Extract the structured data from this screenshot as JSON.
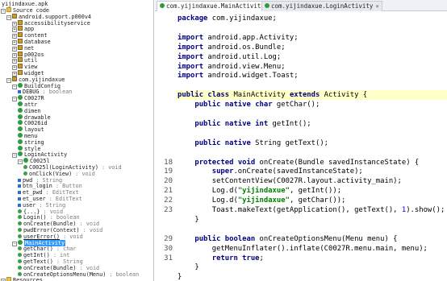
{
  "tree": {
    "root": "yijindaxue.apk",
    "items": [
      {
        "label": "Source code",
        "type": "",
        "indent": 0
      },
      {
        "label": "android.support.p000v4",
        "type": "",
        "indent": 1
      },
      {
        "label": "accessibilityservice",
        "type": "",
        "indent": 2
      },
      {
        "label": "app",
        "type": "",
        "indent": 2
      },
      {
        "label": "content",
        "type": "",
        "indent": 2
      },
      {
        "label": "database",
        "type": "",
        "indent": 2
      },
      {
        "label": "net",
        "type": "",
        "indent": 2
      },
      {
        "label": "p002os",
        "type": "",
        "indent": 2
      },
      {
        "label": "util",
        "type": "",
        "indent": 2
      },
      {
        "label": "view",
        "type": "",
        "indent": 2
      },
      {
        "label": "widget",
        "type": "",
        "indent": 2
      },
      {
        "label": "com.yijindaxue",
        "type": "",
        "indent": 1
      },
      {
        "label": "BuildConfig",
        "type": "",
        "indent": 2
      },
      {
        "label": "DEBUG",
        "type": ": boolean",
        "indent": 3
      },
      {
        "label": "C0027R",
        "type": "",
        "indent": 2
      },
      {
        "label": "attr",
        "type": "",
        "indent": 3
      },
      {
        "label": "dimen",
        "type": "",
        "indent": 3
      },
      {
        "label": "drawable",
        "type": "",
        "indent": 3
      },
      {
        "label": "C0026id",
        "type": "",
        "indent": 3
      },
      {
        "label": "layout",
        "type": "",
        "indent": 3
      },
      {
        "label": "menu",
        "type": "",
        "indent": 3
      },
      {
        "label": "string",
        "type": "",
        "indent": 3
      },
      {
        "label": "style",
        "type": "",
        "indent": 3
      },
      {
        "label": "LoginActivity",
        "type": "",
        "indent": 2
      },
      {
        "label": "C0025l",
        "type": "",
        "indent": 3
      },
      {
        "label": "C0025l(LoginActivity)",
        "type": ": void",
        "indent": 4
      },
      {
        "label": "onClick(View)",
        "type": ": void",
        "indent": 4
      },
      {
        "label": "pwd",
        "type": ": String",
        "indent": 3
      },
      {
        "label": "btn_login",
        "type": ": Button",
        "indent": 3
      },
      {
        "label": "et_pwd",
        "type": ": EditText",
        "indent": 3
      },
      {
        "label": "et_user",
        "type": ": EditText",
        "indent": 3
      },
      {
        "label": "user",
        "type": ": String",
        "indent": 3
      },
      {
        "label": "{...}",
        "type": ": void",
        "indent": 3
      },
      {
        "label": "Login()",
        "type": ": boolean",
        "indent": 3
      },
      {
        "label": "onCreate(Bundle)",
        "type": ": void",
        "indent": 3
      },
      {
        "label": "pwdError(Context)",
        "type": ": void",
        "indent": 3
      },
      {
        "label": "userError()",
        "type": ": void",
        "indent": 3
      },
      {
        "label": "MainActivity",
        "type": "",
        "indent": 2
      },
      {
        "label": "getChar()",
        "type": ": char",
        "indent": 3
      },
      {
        "label": "getInt()",
        "type": ": int",
        "indent": 3
      },
      {
        "label": "getText()",
        "type": ": String",
        "indent": 3
      },
      {
        "label": "onCreate(Bundle)",
        "type": ": void",
        "indent": 3
      },
      {
        "label": "onCreateOptionsMenu(Menu)",
        "type": ": boolean",
        "indent": 3
      },
      {
        "label": "Resources",
        "type": "",
        "indent": 0
      }
    ]
  },
  "tabs": [
    {
      "label": "com.yijindaxue.MainActivity",
      "close": "×"
    },
    {
      "label": "com.yijindaxue.LoginActivity",
      "close": "×"
    }
  ],
  "code": {
    "lines": [
      {
        "ln": "",
        "text": "package com.yijindaxue;"
      },
      {
        "ln": "",
        "text": ""
      },
      {
        "ln": "",
        "text": "import android.app.Activity;"
      },
      {
        "ln": "",
        "text": "import android.os.Bundle;"
      },
      {
        "ln": "",
        "text": "import android.util.Log;"
      },
      {
        "ln": "",
        "text": "import android.view.Menu;"
      },
      {
        "ln": "",
        "text": "import android.widget.Toast;"
      },
      {
        "ln": "",
        "text": ""
      },
      {
        "ln": "",
        "text": "public class MainActivity extends Activity {"
      },
      {
        "ln": "",
        "text": "    public native char getChar();"
      },
      {
        "ln": "",
        "text": ""
      },
      {
        "ln": "",
        "text": "    public native int getInt();"
      },
      {
        "ln": "",
        "text": ""
      },
      {
        "ln": "",
        "text": "    public native String getText();"
      },
      {
        "ln": "",
        "text": ""
      },
      {
        "ln": "18",
        "text": "    protected void onCreate(Bundle savedInstanceState) {"
      },
      {
        "ln": "19",
        "text": "        super.onCreate(savedInstanceState);"
      },
      {
        "ln": "20",
        "text": "        setContentView(C0027R.layout.activity_main);"
      },
      {
        "ln": "21",
        "text": "        Log.d(\"yijindaxue\", getInt());"
      },
      {
        "ln": "22",
        "text": "        Log.d(\"yijindaxue\", getChar());"
      },
      {
        "ln": "23",
        "text": "        Toast.makeText(getApplication(), getText(), 1).show();"
      },
      {
        "ln": "",
        "text": "    }"
      },
      {
        "ln": "",
        "text": ""
      },
      {
        "ln": "29",
        "text": "    public boolean onCreateOptionsMenu(Menu menu) {"
      },
      {
        "ln": "30",
        "text": "        getMenuInflater().inflate(C0027R.menu.main, menu);"
      },
      {
        "ln": "31",
        "text": "        return true;"
      },
      {
        "ln": "",
        "text": "    }"
      },
      {
        "ln": "",
        "text": "}"
      }
    ]
  },
  "colors": {
    "keyword": "#000080",
    "string": "#008000",
    "number": "#0000ff",
    "highlight": "#ffffc8",
    "selection": "#3399ff"
  }
}
